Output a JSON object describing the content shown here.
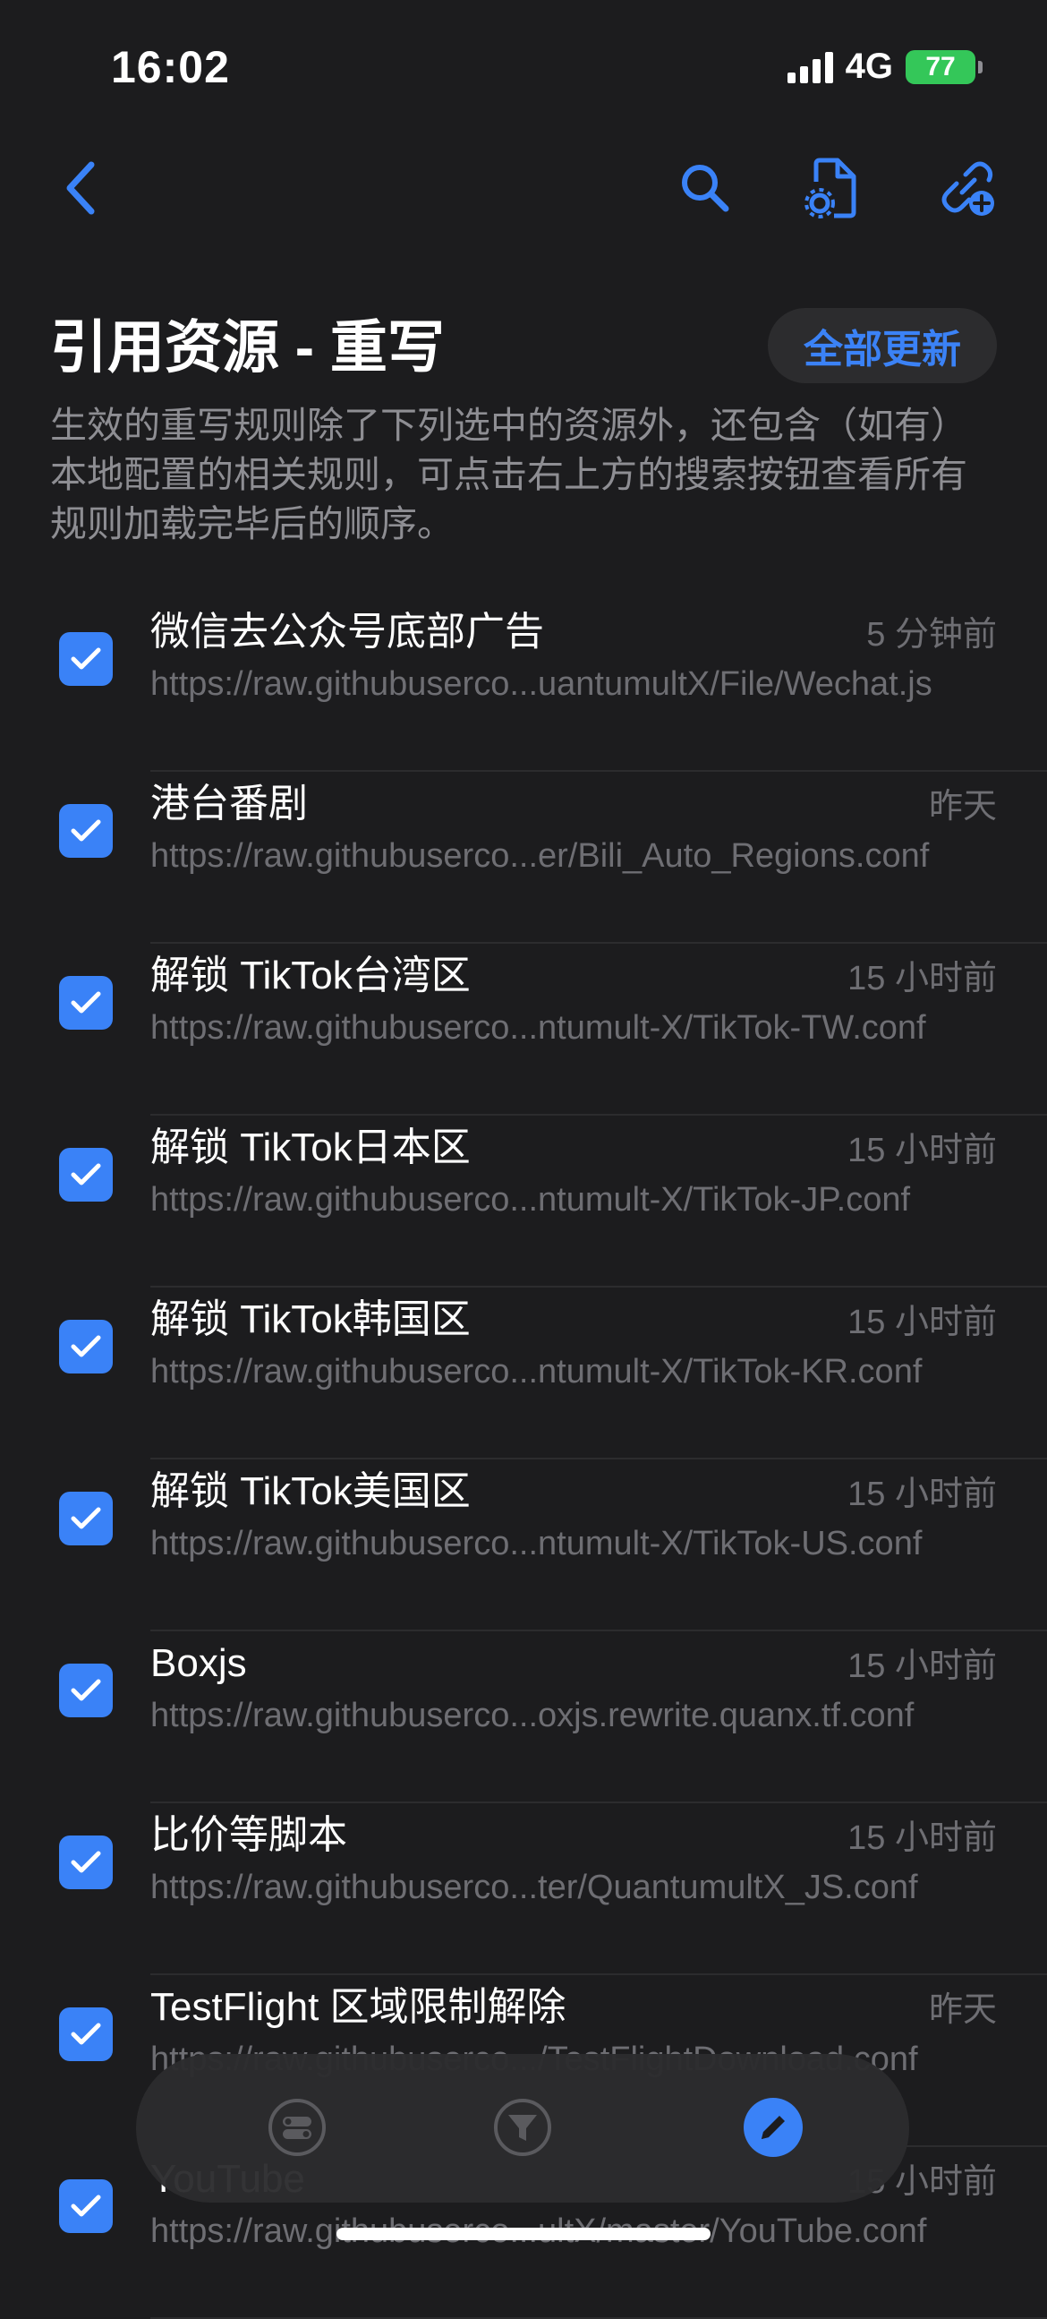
{
  "status_bar": {
    "time": "16:02",
    "network": "4G",
    "battery": "77"
  },
  "nav": {
    "back_icon": "chevron-left-icon",
    "search_icon": "search-icon",
    "file_settings_icon": "file-settings-icon",
    "link_add_icon": "link-add-icon"
  },
  "header": {
    "title": "引用资源 - 重写",
    "update_all": "全部更新",
    "description": "生效的重写规则除了下列选中的资源外，还包含（如有）本地配置的相关规则，可点击右上方的搜索按钮查看所有规则加载完毕后的顺序。"
  },
  "items": [
    {
      "name": "微信去公众号底部广告",
      "time": "5 分钟前",
      "url": "https://raw.githubuserco...uantumultX/File/Wechat.js",
      "checked": true
    },
    {
      "name": "港台番剧",
      "time": "昨天",
      "url": "https://raw.githubuserco...er/Bili_Auto_Regions.conf",
      "checked": true
    },
    {
      "name": "解锁 TikTok台湾区",
      "time": "15 小时前",
      "url": "https://raw.githubuserco...ntumult-X/TikTok-TW.conf",
      "checked": true
    },
    {
      "name": "解锁 TikTok日本区",
      "time": "15 小时前",
      "url": "https://raw.githubuserco...ntumult-X/TikTok-JP.conf",
      "checked": true
    },
    {
      "name": "解锁 TikTok韩国区",
      "time": "15 小时前",
      "url": "https://raw.githubuserco...ntumult-X/TikTok-KR.conf",
      "checked": true
    },
    {
      "name": "解锁 TikTok美国区",
      "time": "15 小时前",
      "url": "https://raw.githubuserco...ntumult-X/TikTok-US.conf",
      "checked": true
    },
    {
      "name": "Boxjs",
      "time": "15 小时前",
      "url": "https://raw.githubuserco...oxjs.rewrite.quanx.tf.conf",
      "checked": true
    },
    {
      "name": "比价等脚本",
      "time": "15 小时前",
      "url": "https://raw.githubuserco...ter/QuantumultX_JS.conf",
      "checked": true
    },
    {
      "name": "TestFlight 区域限制解除",
      "time": "昨天",
      "url": "https://raw.githubuserco.../TestFlightDownload.conf",
      "checked": true
    },
    {
      "name": "YouTube",
      "time": "15 小时前",
      "url": "https://raw.githubuserco...ultX/master/YouTube.conf",
      "checked": true
    }
  ],
  "tab_bar": {
    "rules_icon": "toggle-list-icon",
    "filter_icon": "filter-icon",
    "edit_icon": "pencil-icon",
    "active_tab": "edit"
  },
  "colors": {
    "background": "#1c1c1e",
    "accent": "#3a82f7",
    "secondary_text": "#8e8e93",
    "battery": "#34c759"
  }
}
